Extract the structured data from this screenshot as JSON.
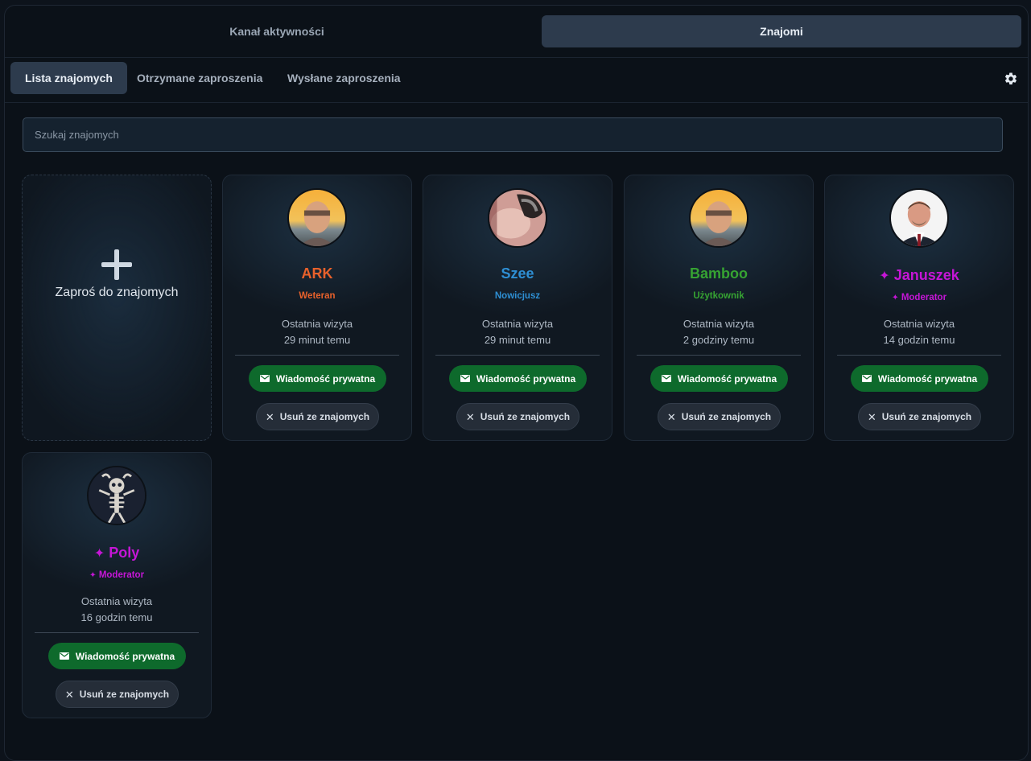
{
  "tabs": {
    "activity": "Kanał aktywności",
    "friends": "Znajomi"
  },
  "subtabs": [
    "Lista znajomych",
    "Otrzymane zaproszenia",
    "Wysłane zaproszenia"
  ],
  "search": {
    "placeholder": "Szukaj znajomych",
    "value": ""
  },
  "invite": {
    "label": "Zaproś do znajomych"
  },
  "labels": {
    "last_visit": "Ostatnia wizyta",
    "message": "Wiadomość prywatna",
    "remove": "Usuń ze znajomych",
    "mod_mark": "✦"
  },
  "friends": [
    {
      "name": "ARK",
      "role": "Weteran",
      "last_seen": "29 minut temu",
      "color": "#e8612b",
      "avatar": "teen-photo",
      "moderator": false
    },
    {
      "name": "Szee",
      "role": "Nowicjusz",
      "last_seen": "29 minut temu",
      "color": "#2e8fd4",
      "avatar": "abstract-photo",
      "moderator": false
    },
    {
      "name": "Bamboo",
      "role": "Użytkownik",
      "last_seen": "2 godziny temu",
      "color": "#36a332",
      "avatar": "teen-photo",
      "moderator": false
    },
    {
      "name": "Januszek",
      "role": "Moderator",
      "last_seen": "14 godzin temu",
      "color": "#c516d6",
      "avatar": "man-suit-photo",
      "moderator": true
    },
    {
      "name": "Poly",
      "role": "Moderator",
      "last_seen": "16 godzin temu",
      "color": "#c516d6",
      "avatar": "skeleton-drawing",
      "moderator": true
    }
  ],
  "colors": {
    "accent": "#2d3b4d",
    "message_button": "#0e6a2c",
    "background": "#0b1118"
  }
}
